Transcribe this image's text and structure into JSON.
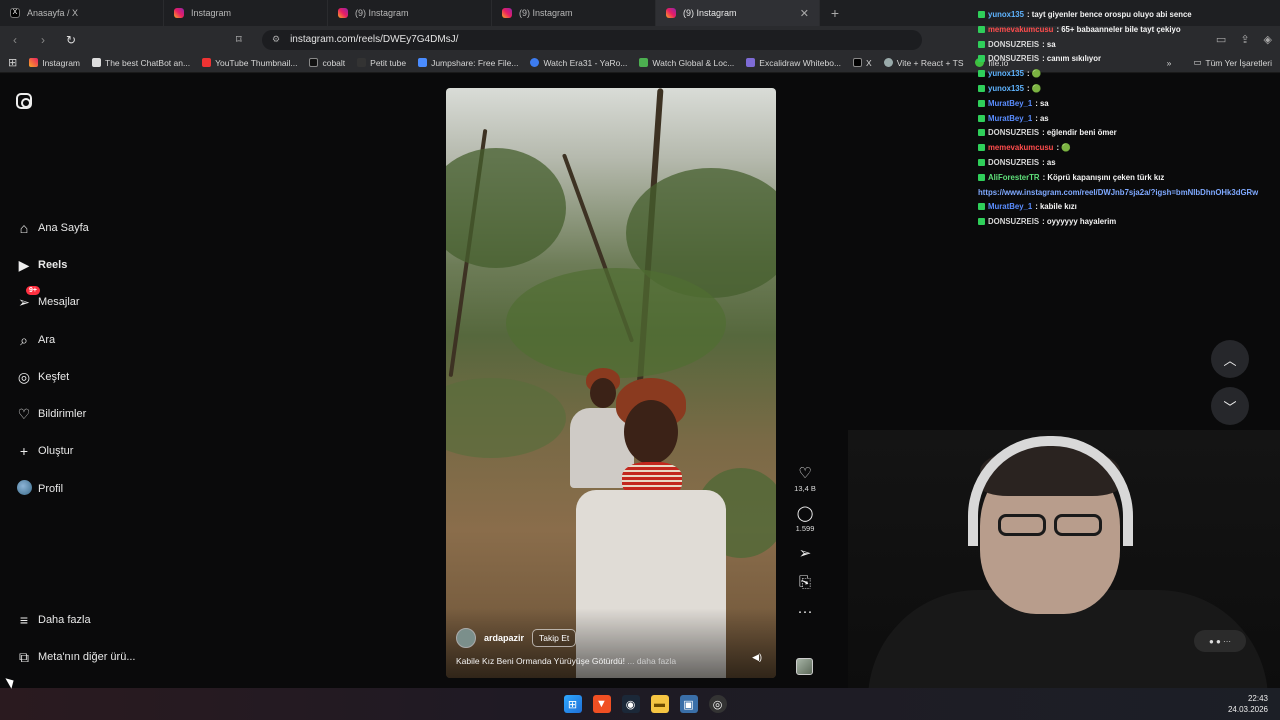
{
  "browser": {
    "tabs": [
      {
        "title": "Anasayfa / X",
        "icon": "x-logo-icon",
        "active": false
      },
      {
        "title": "Instagram",
        "icon": "instagram-icon",
        "active": false
      },
      {
        "title": "(9) Instagram",
        "icon": "instagram-icon",
        "active": false
      },
      {
        "title": "(9) Instagram",
        "icon": "instagram-icon",
        "active": false
      },
      {
        "title": "(9) Instagram",
        "icon": "instagram-icon",
        "active": true
      }
    ],
    "new_tab": "+",
    "url": "instagram.com/reels/DWEy7G4DMsJ/",
    "bookmarks": [
      "Instagram",
      "The best ChatBot an...",
      "YouTube Thumbnail...",
      "cobalt",
      "Petit tube",
      "Jumpshare: Free File...",
      "Watch Era31 - YaRo...",
      "Watch Global & Loc...",
      "Excalidraw Whitebo...",
      "X",
      "Vite + React + TS",
      "file.io"
    ],
    "all_bookmarks": "Tüm Yer İşaretleri",
    "overflow": "»"
  },
  "sidebar": {
    "items": [
      {
        "label": "Ana Sayfa",
        "icon": "home-icon"
      },
      {
        "label": "Reels",
        "icon": "reels-icon"
      },
      {
        "label": "Mesajlar",
        "icon": "messages-icon",
        "badge": "9+"
      },
      {
        "label": "Ara",
        "icon": "search-icon"
      },
      {
        "label": "Keşfet",
        "icon": "compass-icon"
      },
      {
        "label": "Bildirimler",
        "icon": "heart-icon"
      },
      {
        "label": "Oluştur",
        "icon": "plus-icon"
      },
      {
        "label": "Profil",
        "icon": "avatar-icon"
      }
    ],
    "more": "Daha fazla",
    "meta": "Meta'nın diğer ürü..."
  },
  "reel": {
    "author": "ardapazir",
    "follow_label": "Takip Et",
    "caption": "Kabile Kız Beni Ormanda Yürüyüşe Götürdü!",
    "more_label": "... daha fazla",
    "likes": "13,4 B",
    "comments": "1.599"
  },
  "chat": {
    "lines": [
      {
        "user": "yunox135",
        "color": "#5fb4ff",
        "msg": " : tayt giyenler bence orospu oluyo abi sence"
      },
      {
        "user": "memevakumcusu",
        "color": "#ff4d4d",
        "msg": " : 65+ babaanneler bile tayt çekiyo"
      },
      {
        "user": "DONSUZREIS",
        "color": "#d6d6d6",
        "msg": " : sa"
      },
      {
        "user": "DONSUZREIS",
        "color": "#d6d6d6",
        "msg": " : canım sıkılıyor"
      },
      {
        "user": "yunox135",
        "color": "#5fb4ff",
        "msg": " : 🟢"
      },
      {
        "user": "yunox135",
        "color": "#5fb4ff",
        "msg": " : 🟢"
      },
      {
        "user": "MuratBey_1",
        "color": "#5a8dff",
        "msg": " : sa"
      },
      {
        "user": "MuratBey_1",
        "color": "#5a8dff",
        "msg": " : as"
      },
      {
        "user": "DONSUZREIS",
        "color": "#d6d6d6",
        "msg": " : eğlendir beni ömer"
      },
      {
        "user": "memevakumcusu",
        "color": "#ff4d4d",
        "msg": " : 🟢"
      },
      {
        "user": "DONSUZREIS",
        "color": "#d6d6d6",
        "msg": " : as"
      },
      {
        "user": "AliForesterTR",
        "color": "#5fe07a",
        "msg": " : Köprü kapanışını çeken türk kız"
      },
      {
        "user": "",
        "color": "#7fa9ff",
        "msg": "https://www.instagram.com/reel/DWJnb7sja2a/?igsh=bmNlbDhnOHk3dGRw"
      },
      {
        "user": "MuratBey_1",
        "color": "#5a8dff",
        "msg": " : kabile kızı"
      },
      {
        "user": "DONSUZREIS",
        "color": "#d6d6d6",
        "msg": " : oyyyyyy hayalerim"
      }
    ]
  },
  "taskbar": {
    "time": "22:43",
    "date": "24.03.2026"
  },
  "colors": {
    "accent_badge": "#ff3040",
    "page_bg": "#0a0a0b",
    "chat_badge": "#2fcf5a"
  }
}
